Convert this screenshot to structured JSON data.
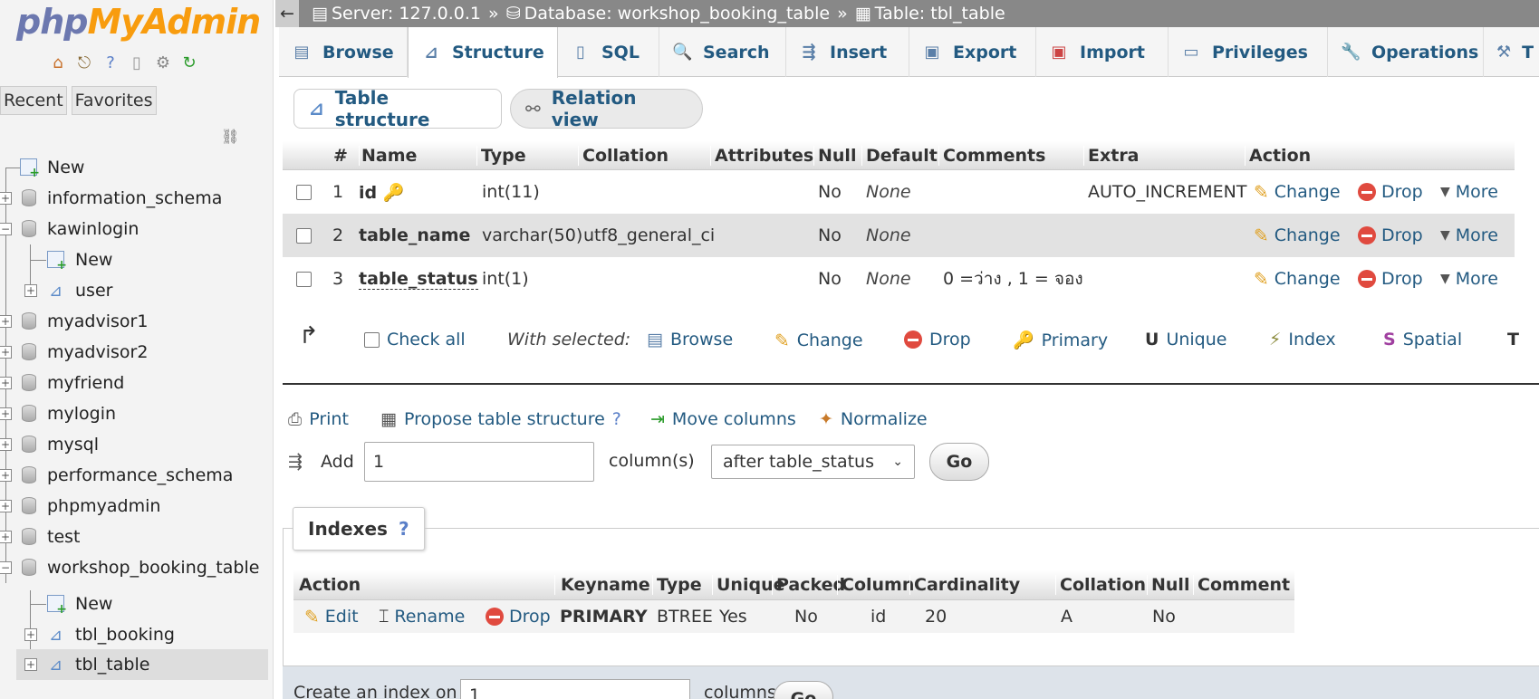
{
  "sidebar": {
    "logo_php": "php",
    "logo_myadmin": "MyAdmin",
    "tab_recent": "Recent",
    "tab_favorites": "Favorites",
    "tree": [
      {
        "label": "New"
      },
      {
        "label": "information_schema"
      },
      {
        "label": "kawinlogin"
      },
      {
        "label": "New"
      },
      {
        "label": "user"
      },
      {
        "label": "myadvisor1"
      },
      {
        "label": "myadvisor2"
      },
      {
        "label": "myfriend"
      },
      {
        "label": "mylogin"
      },
      {
        "label": "mysql"
      },
      {
        "label": "performance_schema"
      },
      {
        "label": "phpmyadmin"
      },
      {
        "label": "test"
      },
      {
        "label": "workshop_booking_table"
      },
      {
        "label": "New"
      },
      {
        "label": "tbl_booking"
      },
      {
        "label": "tbl_table"
      }
    ]
  },
  "breadcrumb": {
    "back": "←",
    "server": "Server: 127.0.0.1",
    "database": "Database: workshop_booking_table",
    "table": "Table: tbl_table",
    "sep": "»"
  },
  "tabs": [
    "Browse",
    "Structure",
    "SQL",
    "Search",
    "Insert",
    "Export",
    "Import",
    "Privileges",
    "Operations",
    "T"
  ],
  "subtabs": {
    "structure": "Table structure",
    "relation": "Relation view"
  },
  "structure": {
    "headers": [
      "#",
      "Name",
      "Type",
      "Collation",
      "Attributes",
      "Null",
      "Default",
      "Comments",
      "Extra",
      "Action"
    ],
    "rows": [
      {
        "num": "1",
        "name": "id",
        "type": "int(11)",
        "collation": "",
        "attributes": "",
        "null": "No",
        "default": "None",
        "comments": "",
        "extra": "AUTO_INCREMENT"
      },
      {
        "num": "2",
        "name": "table_name",
        "type": "varchar(50)",
        "collation": "utf8_general_ci",
        "attributes": "",
        "null": "No",
        "default": "None",
        "comments": "",
        "extra": ""
      },
      {
        "num": "3",
        "name": "table_status",
        "type": "int(1)",
        "collation": "",
        "attributes": "",
        "null": "No",
        "default": "None",
        "comments": "0 =ว่าง , 1 = จอง",
        "extra": ""
      }
    ],
    "action_change": "Change",
    "action_drop": "Drop",
    "action_more": "More"
  },
  "bulk": {
    "check_all": "Check all",
    "with_selected": "With selected:",
    "browse": "Browse",
    "change": "Change",
    "drop": "Drop",
    "primary": "Primary",
    "unique": "Unique",
    "index": "Index",
    "spatial": "Spatial"
  },
  "tools": {
    "print": "Print",
    "propose": "Propose table structure",
    "move": "Move columns",
    "normalize": "Normalize"
  },
  "add": {
    "label": "Add",
    "value": "1",
    "columns_label": "column(s)",
    "position": "after table_status",
    "go": "Go"
  },
  "indexes": {
    "title": "Indexes",
    "headers": [
      "Action",
      "Keyname",
      "Type",
      "Unique",
      "Packed",
      "Column",
      "Cardinality",
      "Collation",
      "Null",
      "Comment"
    ],
    "row": {
      "edit": "Edit",
      "rename": "Rename",
      "drop": "Drop",
      "keyname": "PRIMARY",
      "type": "BTREE",
      "unique": "Yes",
      "packed": "No",
      "column": "id",
      "cardinality": "20",
      "collation": "A",
      "null": "No",
      "comment": ""
    }
  },
  "create_index": {
    "label": "Create an index on",
    "value": "1",
    "columns": "columns",
    "go": "Go"
  }
}
